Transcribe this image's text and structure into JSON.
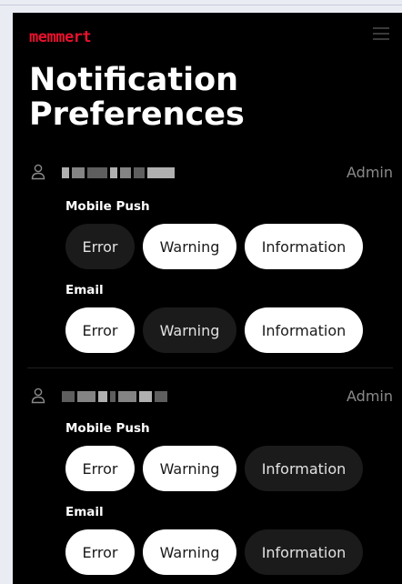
{
  "app": {
    "logo_text": "memmert",
    "brand_color": "#e8112d"
  },
  "header": {
    "title": "Notification\nPreferences"
  },
  "users": [
    {
      "role": "Admin",
      "mobile_push": {
        "label": "Mobile Push",
        "options": [
          {
            "label": "Error",
            "selected": false
          },
          {
            "label": "Warning",
            "selected": true
          },
          {
            "label": "Information",
            "selected": true
          }
        ]
      },
      "email": {
        "label": "Email",
        "options": [
          {
            "label": "Error",
            "selected": true
          },
          {
            "label": "Warning",
            "selected": false
          },
          {
            "label": "Information",
            "selected": true
          }
        ]
      }
    },
    {
      "role": "Admin",
      "mobile_push": {
        "label": "Mobile Push",
        "options": [
          {
            "label": "Error",
            "selected": true
          },
          {
            "label": "Warning",
            "selected": true
          },
          {
            "label": "Information",
            "selected": false
          }
        ]
      },
      "email": {
        "label": "Email",
        "options": [
          {
            "label": "Error",
            "selected": true
          },
          {
            "label": "Warning",
            "selected": true
          },
          {
            "label": "Information",
            "selected": false
          }
        ]
      }
    }
  ]
}
